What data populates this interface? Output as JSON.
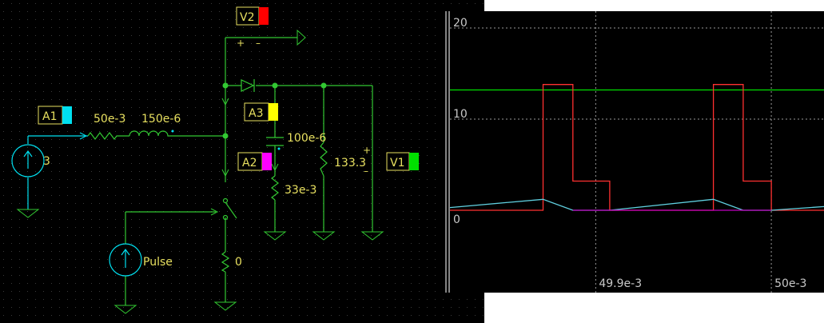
{
  "schematic": {
    "meters": {
      "a1": {
        "label": "A1",
        "color": "#00e0f0"
      },
      "a2": {
        "label": "A2",
        "color": "#ff00ff"
      },
      "a3": {
        "label": "A3",
        "color": "#ffff00"
      },
      "v1": {
        "label": "V1",
        "color": "#00e000"
      },
      "v2": {
        "label": "V2",
        "color": "#ff0000"
      }
    },
    "components": {
      "source_current": "3",
      "r_series": "50e-3",
      "inductor": "150e-6",
      "capacitor": "100e-6",
      "esr": "33e-3",
      "load": "133.3",
      "pulse_source": "Pulse",
      "r_switch": "0"
    },
    "polarity": {
      "plus": "+",
      "minus": "–"
    }
  },
  "chart_data": {
    "type": "line",
    "y_ticks": [
      "20",
      "10",
      "0"
    ],
    "x_ticks": [
      "49.9e-3",
      "50e-3"
    ],
    "ylim": [
      -2.5,
      22
    ],
    "grid": true,
    "series": [
      {
        "color": "#00e000",
        "points": [
          [
            49.817,
            13.2
          ],
          [
            50.03,
            13.2
          ]
        ]
      },
      {
        "color": "#ff3030",
        "points": [
          [
            49.817,
            0
          ],
          [
            49.87,
            0
          ],
          [
            49.87,
            13.8
          ],
          [
            49.887,
            13.8
          ],
          [
            49.887,
            3.2
          ],
          [
            49.908,
            3.2
          ],
          [
            49.908,
            0
          ],
          [
            49.967,
            0
          ],
          [
            49.967,
            13.8
          ],
          [
            49.984,
            13.8
          ],
          [
            49.984,
            3.2
          ],
          [
            50.0,
            3.2
          ],
          [
            50.0,
            0
          ],
          [
            50.03,
            0
          ]
        ]
      },
      {
        "color": "#60d0e0",
        "points": [
          [
            49.817,
            0.3
          ],
          [
            49.87,
            1.2
          ],
          [
            49.887,
            0
          ],
          [
            49.908,
            0
          ],
          [
            49.967,
            1.2
          ],
          [
            49.984,
            0
          ],
          [
            50.0,
            0
          ],
          [
            50.03,
            0.4
          ]
        ]
      },
      {
        "color": "#c000c0",
        "points": [
          [
            49.887,
            0
          ],
          [
            49.908,
            0
          ],
          [
            49.984,
            0
          ],
          [
            50.0,
            0
          ]
        ]
      }
    ]
  }
}
